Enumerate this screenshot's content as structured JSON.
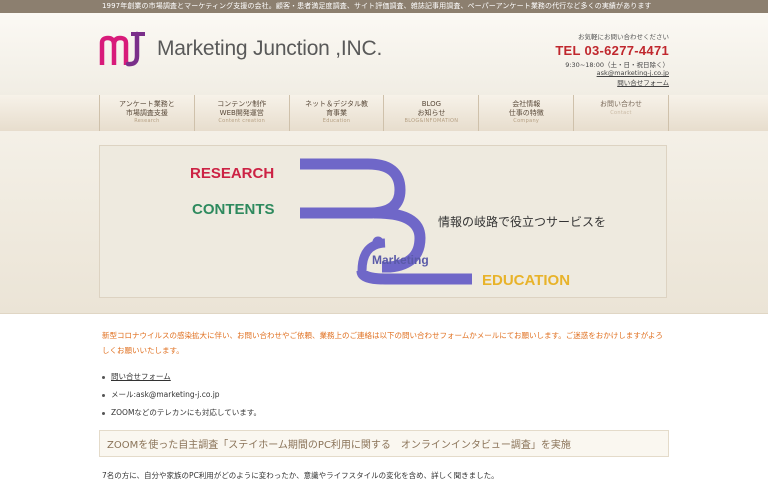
{
  "top_bar": {
    "text": "1997年創業の市場調査とマーケティング支援の会社。顧客・患者満足度調査、サイト評価調査、雑誌記事用調査、ペーパーアンケート業務の代行など多くの実績があります"
  },
  "header": {
    "logo_mark": "mJ",
    "company_name": "Marketing Junction ,INC.",
    "contact_invite": "お気軽にお問い合わせください",
    "tel": "TEL 03-6277-4471",
    "hours": "9:30~18:00（土・日・祝日除く）",
    "email": "ask@marketing-j.co.jp",
    "contact_form": "問い合せフォーム"
  },
  "nav": [
    {
      "label": "アンケート業務と\n市場調査支援",
      "sub": "Research"
    },
    {
      "label": "コンテンツ制作\nWEB開発運営",
      "sub": "Content creation"
    },
    {
      "label": "ネット＆デジタル教\n育事業",
      "sub": "Education"
    },
    {
      "label": "BLOG\nお知らせ",
      "sub": "BLOG&INFOMATION"
    },
    {
      "label": "会社情報\n仕事の特徴",
      "sub": "Company"
    },
    {
      "label": "お問い合わせ",
      "sub": "Contact"
    }
  ],
  "hero": {
    "research": "RESEARCH",
    "contents": "CONTENTS",
    "tagline": "情報の岐路で役立つサービスを",
    "marketing": "Marketing",
    "education": "EDUCATION"
  },
  "colors": {
    "research": "#cc2244",
    "contents": "#2e8a5e",
    "marketing": "#5a5aa8",
    "education": "#e8b32a",
    "band": "#6f67c8",
    "tel": "#c0272d",
    "notice": "#e07020"
  },
  "notice": "新型コロナウイルスの感染拡大に伴い、お問い合わせやご依頼、業務上のご連絡は以下の問い合わせフォームかメールにてお願いします。ご迷惑をおかけしますがよろしくお願いいたします。",
  "links": {
    "form": "問い合せフォーム",
    "mail": "メール:ask@marketing-j.co.jp",
    "zoom": "ZOOMなどのテレカンにも対応しています。"
  },
  "section_title": "ZOOMを使った自主調査「ステイホーム期間のPC利用に関する　オンラインインタビュー調査」を実施",
  "body_text": "7名の方に、自分や家族のPC利用がどのように変わったか、意識やライフスタイルの変化を含め、詳しく聞きました。"
}
